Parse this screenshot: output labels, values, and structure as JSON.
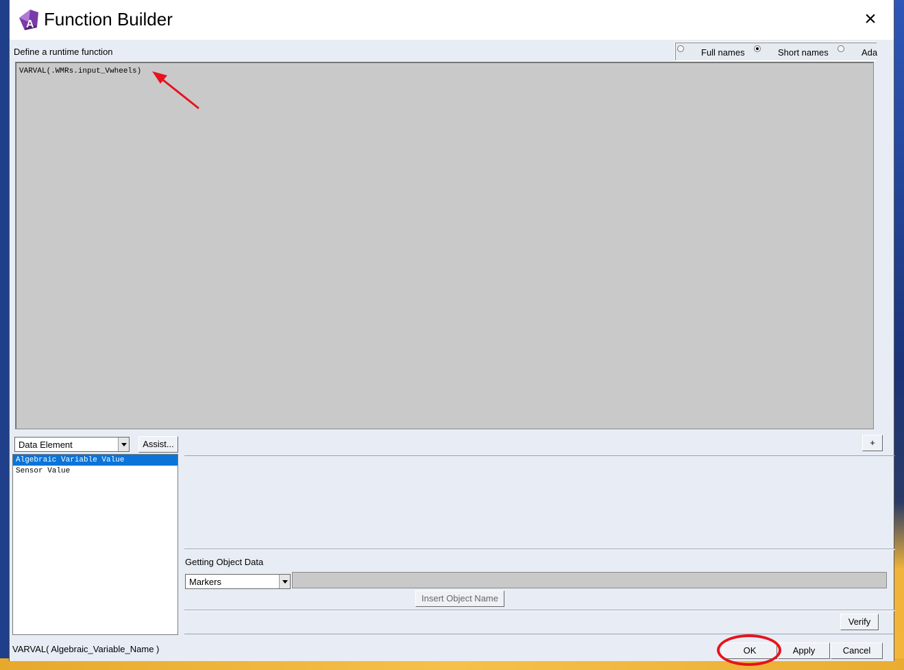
{
  "window": {
    "title": "Function Builder",
    "close_glyph": "×"
  },
  "section": {
    "define_label": "Define a runtime function"
  },
  "name_mode": {
    "options": [
      {
        "label": "Full names",
        "selected": false
      },
      {
        "label": "Short names",
        "selected": true
      },
      {
        "label": "Ada",
        "selected": false
      }
    ]
  },
  "editor": {
    "content": "VARVAL(.WMRs.input_Vwheels)"
  },
  "category": {
    "selected": "Data Element",
    "assist_label": "Assist..."
  },
  "plus_button_label": "+",
  "function_list": {
    "items": [
      {
        "label": "Algebraic Variable Value",
        "selected": true
      },
      {
        "label": "Sensor Value",
        "selected": false
      }
    ]
  },
  "object_data": {
    "label": "Getting Object Data",
    "type_selected": "Markers",
    "insert_label": "Insert Object Name"
  },
  "verify_label": "Verify",
  "status": {
    "signature": "VARVAL( Algebraic_Variable_Name )"
  },
  "footer": {
    "ok_label": "OK",
    "apply_label": "Apply",
    "cancel_label": "Cancel"
  },
  "colors": {
    "selection": "#0a74d9",
    "annotation_red": "#e8121c",
    "editor_bg": "#c9c9c9"
  }
}
